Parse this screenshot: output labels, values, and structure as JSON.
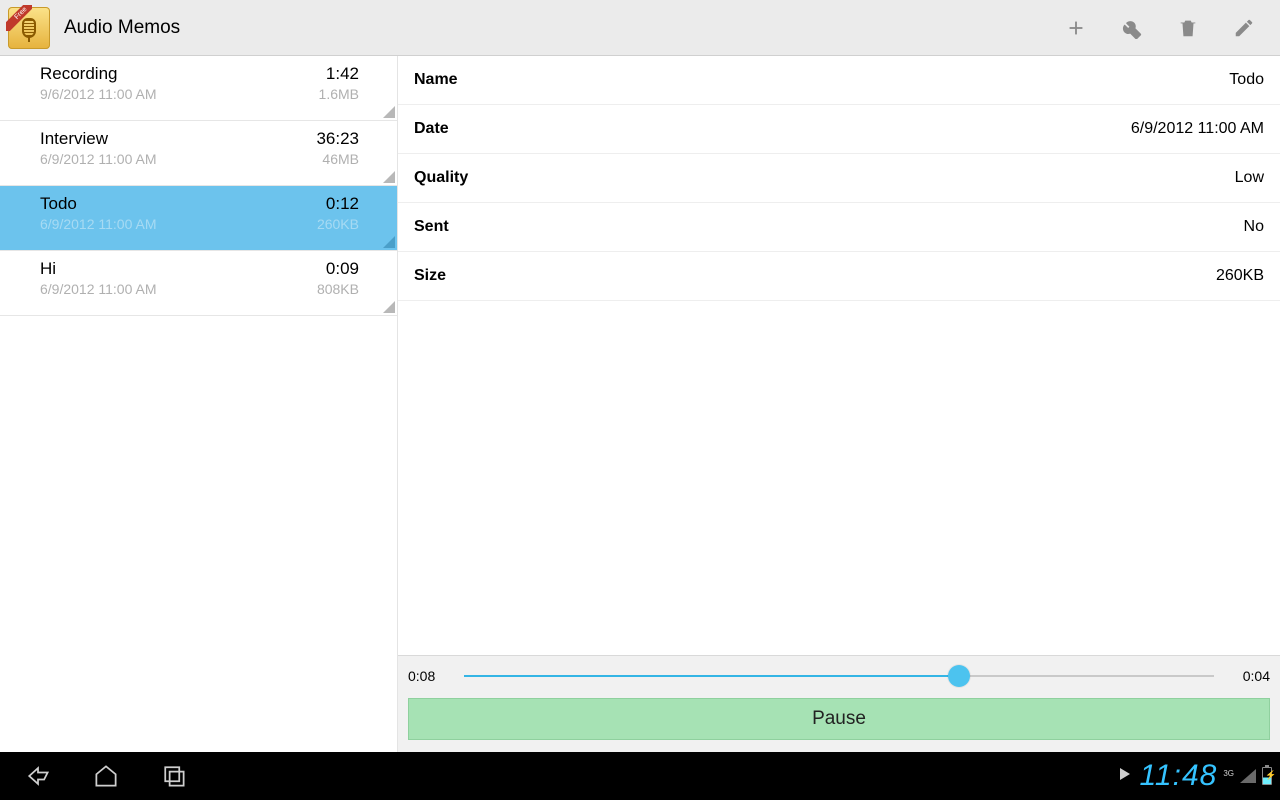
{
  "header": {
    "title": "Audio Memos"
  },
  "memos": [
    {
      "title": "Recording",
      "datetime": "9/6/2012 11:00 AM",
      "duration": "1:42",
      "size": "1.6MB",
      "selected": false
    },
    {
      "title": "Interview",
      "datetime": "6/9/2012 11:00 AM",
      "duration": "36:23",
      "size": "46MB",
      "selected": false
    },
    {
      "title": "Todo",
      "datetime": "6/9/2012 11:00 AM",
      "duration": "0:12",
      "size": "260KB",
      "selected": true
    },
    {
      "title": "Hi",
      "datetime": "6/9/2012 11:00 AM",
      "duration": "0:09",
      "size": "808KB",
      "selected": false
    }
  ],
  "detail": {
    "rows": [
      {
        "key": "Name",
        "value": "Todo"
      },
      {
        "key": "Date",
        "value": "6/9/2012 11:00 AM"
      },
      {
        "key": "Quality",
        "value": "Low"
      },
      {
        "key": "Sent",
        "value": "No"
      },
      {
        "key": "Size",
        "value": "260KB"
      }
    ]
  },
  "player": {
    "elapsed": "0:08",
    "remaining": "0:04",
    "progress_percent": 66,
    "button_label": "Pause"
  },
  "statusbar": {
    "clock": "11:48",
    "network": "3G"
  }
}
